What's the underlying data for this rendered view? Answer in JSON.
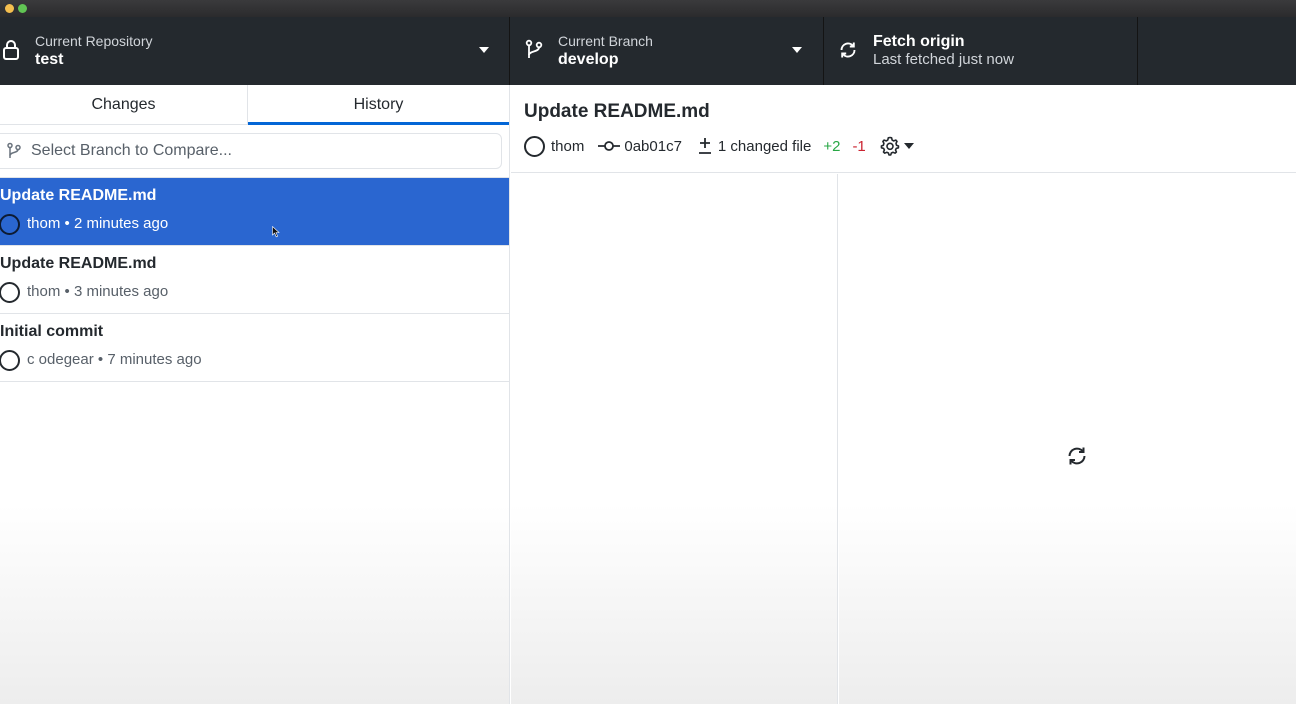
{
  "toolbar": {
    "repository": {
      "label": "Current Repository",
      "value": "test"
    },
    "branch": {
      "label": "Current Branch",
      "value": "develop"
    },
    "fetch": {
      "label": "Fetch origin",
      "status": "Last fetched just now"
    }
  },
  "sidebar": {
    "tabs": [
      {
        "label": "Changes",
        "active": false
      },
      {
        "label": "History",
        "active": true
      }
    ],
    "compare": {
      "placeholder": "Select Branch to Compare..."
    },
    "commits": [
      {
        "title": "Update README.md",
        "author": "thom",
        "time": "2 minutes ago",
        "selected": true
      },
      {
        "title": "Update README.md",
        "author": "thom",
        "time": "3 minutes ago",
        "selected": false
      },
      {
        "title": "Initial commit",
        "author": "c odegear",
        "time": "7 minutes ago",
        "selected": false
      }
    ]
  },
  "commit_detail": {
    "summary": "Update README.md",
    "author": "thom",
    "sha": "0ab01c7",
    "changed_files": "1 changed file",
    "additions": "+2",
    "deletions": "-1"
  },
  "colors": {
    "toolbar_bg": "#24292e",
    "selection": "#2a66d0",
    "tab_indicator": "#0366d6",
    "added": "#28a745",
    "removed": "#cb2431"
  },
  "icons": {
    "repository": "lock-icon",
    "branch": "git-branch-icon",
    "fetch": "sync-icon",
    "commit": "git-commit-icon",
    "diff": "diff-icon",
    "settings": "gear-icon",
    "loading": "sync-spinner-icon"
  }
}
